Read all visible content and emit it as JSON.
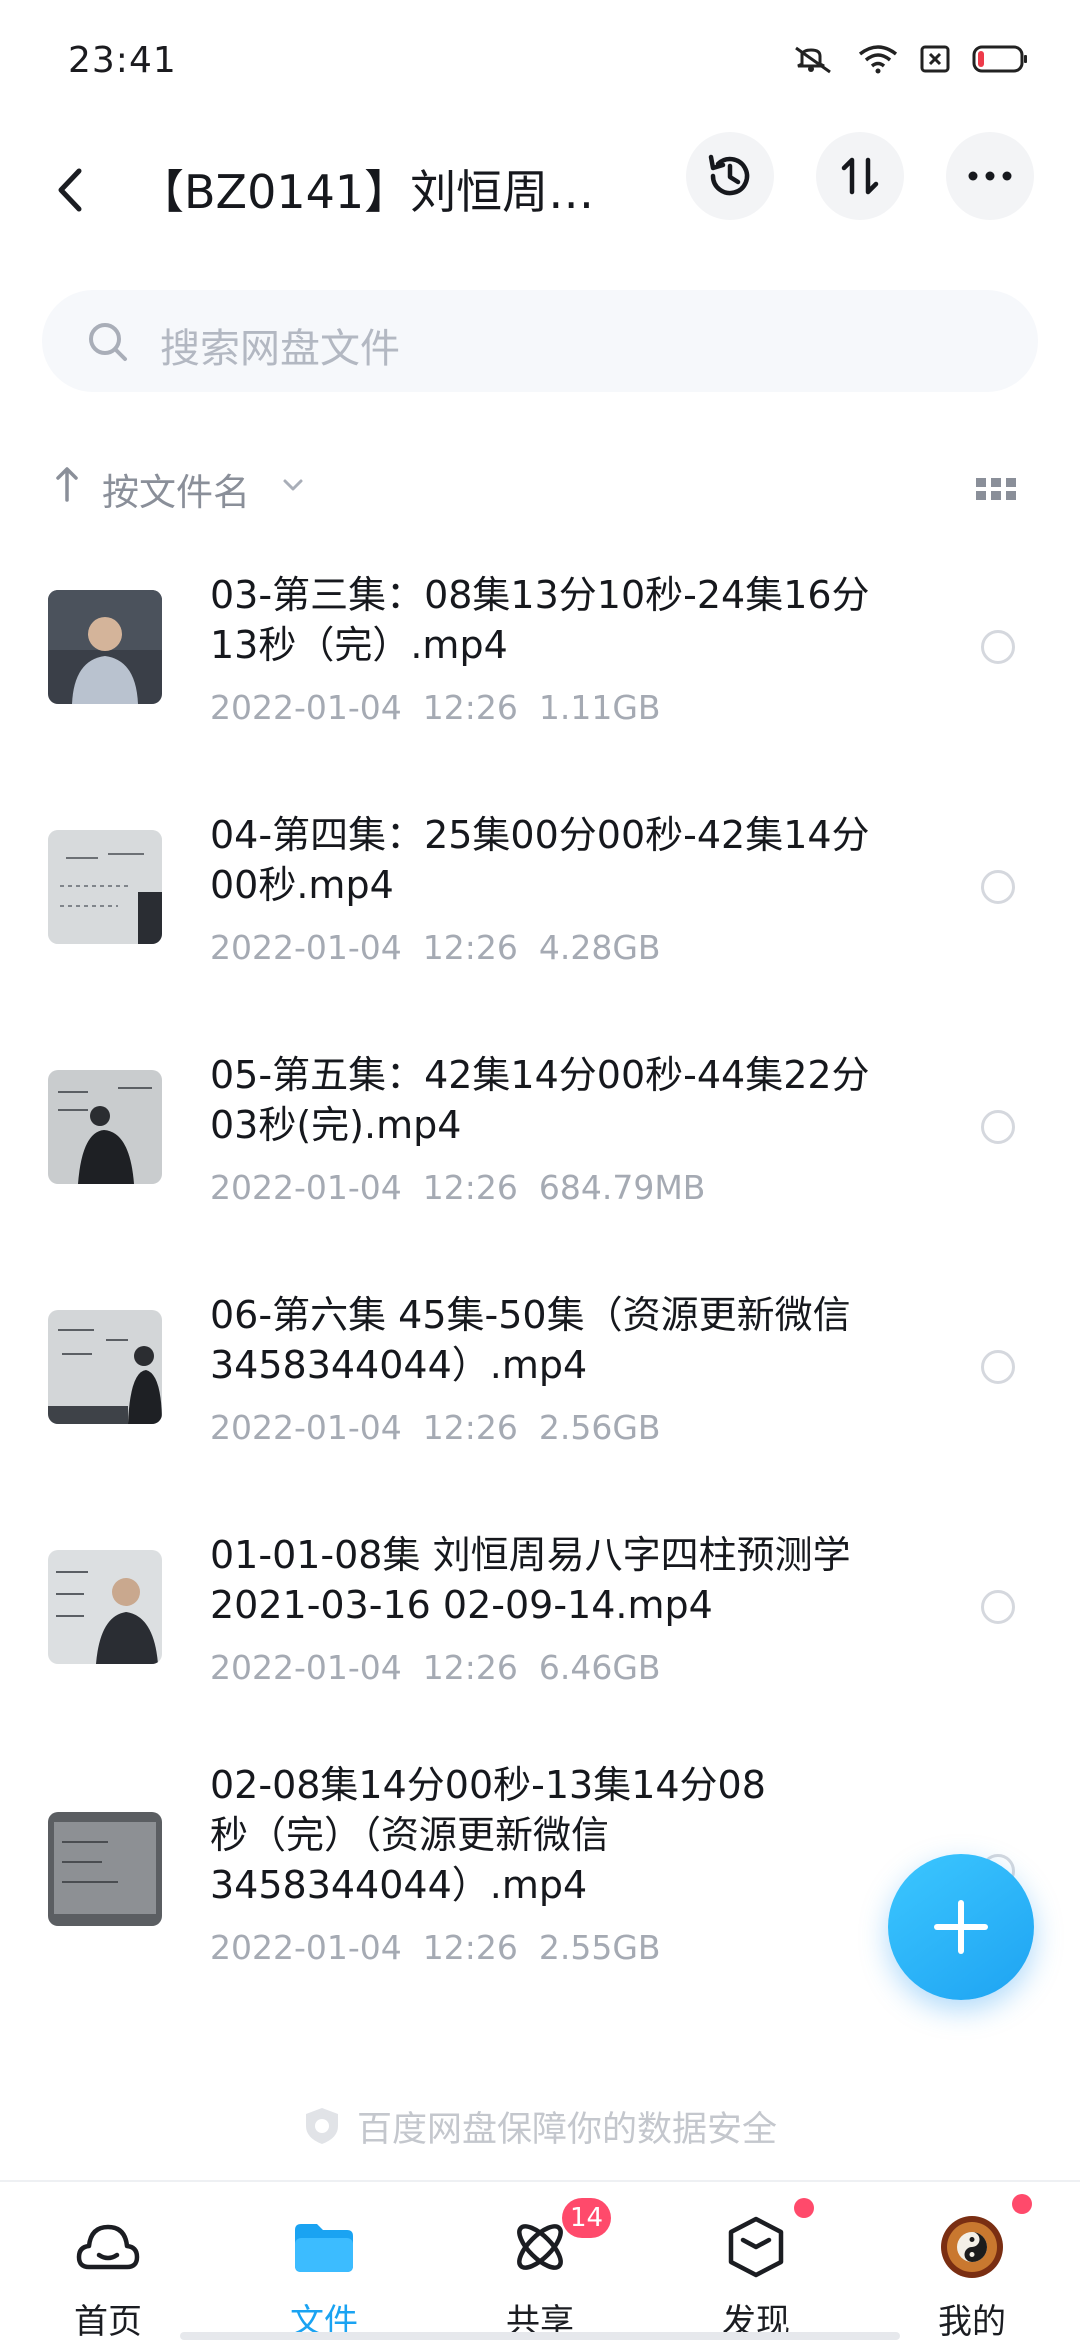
{
  "status_bar": {
    "time": "23:41"
  },
  "header": {
    "title": "【BZ0141】刘恒周…"
  },
  "search": {
    "placeholder": "搜索网盘文件"
  },
  "sort": {
    "label": "按文件名"
  },
  "files": [
    {
      "name": "03-第三集：08集13分10秒-24集16分13秒（完）.mp4",
      "date": "2022-01-04  12:26",
      "size": "1.11GB",
      "thumb": "person"
    },
    {
      "name": "04-第四集：25集00分00秒-42集14分00秒.mp4",
      "date": "2022-01-04  12:26",
      "size": "4.28GB",
      "thumb": "board"
    },
    {
      "name": "05-第五集：42集14分00秒-44集22分03秒(完).mp4",
      "date": "2022-01-04  12:26",
      "size": "684.79MB",
      "thumb": "board-person"
    },
    {
      "name": "06-第六集 45集-50集（资源更新微信3458344044）.mp4",
      "date": "2022-01-04  12:26",
      "size": "2.56GB",
      "thumb": "board-person"
    },
    {
      "name": "01-01-08集 刘恒周易八字四柱预测学2021-03-16 02-09-14.mp4",
      "date": "2022-01-04  12:26",
      "size": "6.46GB",
      "thumb": "board-person"
    },
    {
      "name": "02-08集14分00秒-13集14分08秒（完）（资源更新微信3458344044）.mp4",
      "date": "2022-01-04  12:26",
      "size": "2.55GB",
      "thumb": "dark-board"
    }
  ],
  "footer": {
    "safety_note": "百度网盘保障你的数据安全"
  },
  "nav": {
    "items": [
      {
        "label": "首页",
        "icon": "cloud-home-icon"
      },
      {
        "label": "文件",
        "icon": "folder-icon"
      },
      {
        "label": "共享",
        "icon": "share-atom-icon",
        "badge": "14"
      },
      {
        "label": "发现",
        "icon": "discover-cube-icon"
      },
      {
        "label": "我的",
        "icon": "avatar-icon"
      }
    ],
    "active_index": 1
  },
  "colors": {
    "accent": "#1aa3f2",
    "badge": "#ff4a6b",
    "secondary_text": "#a5aab3"
  }
}
